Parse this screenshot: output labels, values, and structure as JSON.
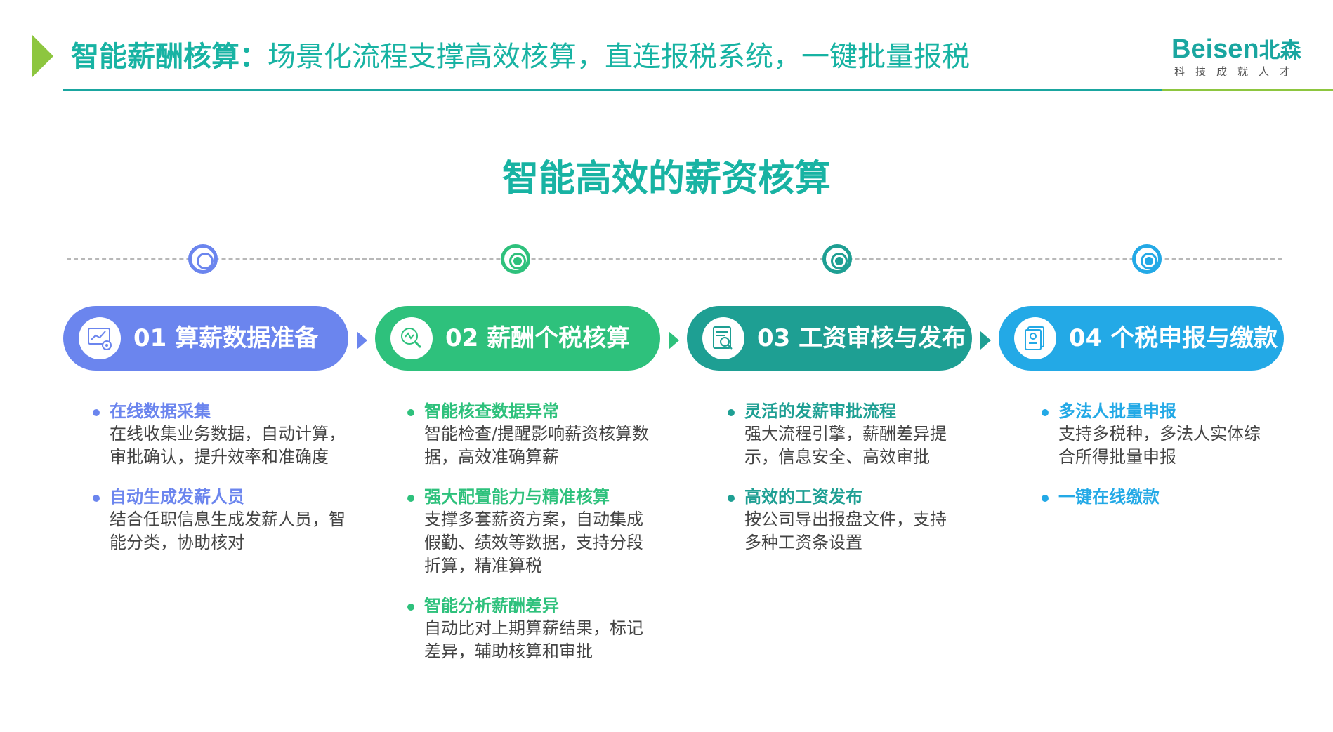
{
  "header": {
    "title_bold": "智能薪酬核算：",
    "title_rest": "场景化流程支撑高效核算，直连报税系统，一键批量报税",
    "logo_word": "Beisen",
    "logo_cn": "北森",
    "logo_sub": "科技成就人才"
  },
  "section_title": "智能高效的薪资核算",
  "colors": {
    "teal": "#18b3a3",
    "green_accent": "#8dc63f",
    "step1": "#6b85ee",
    "step2": "#2ec17c",
    "step3": "#1e9f93",
    "step4": "#23a9e6"
  },
  "steps": [
    {
      "label": "01 算薪数据准备",
      "icon": "data-chart-icon",
      "items": [
        {
          "title": "在线数据采集",
          "desc": "在线收集业务数据，自动计算，审批确认，提升效率和准确度"
        },
        {
          "title": "自动生成发薪人员",
          "desc": "结合任职信息生成发薪人员，智能分类，协助核对"
        }
      ]
    },
    {
      "label": "02 薪酬个税核算",
      "icon": "magnifier-check-icon",
      "items": [
        {
          "title": "智能核查数据异常",
          "desc": "智能检查/提醒影响薪资核算数据，高效准确算薪"
        },
        {
          "title": "强大配置能力与精准核算",
          "desc": "支撑多套薪资方案，自动集成假勤、绩效等数据，支持分段折算，精准算税"
        },
        {
          "title": "智能分析薪酬差异",
          "desc": "自动比对上期算薪结果，标记差异，辅助核算和审批"
        }
      ]
    },
    {
      "label": "03 工资审核与发布",
      "icon": "document-search-icon",
      "items": [
        {
          "title": "灵活的发薪审批流程",
          "desc": "强大流程引擎，薪酬差异提示，信息安全、高效审批"
        },
        {
          "title": "高效的工资发布",
          "desc": "按公司导出报盘文件，支持多种工资条设置"
        }
      ]
    },
    {
      "label": "04 个税申报与缴款",
      "icon": "tax-document-icon",
      "items": [
        {
          "title": "多法人批量申报",
          "desc": "支持多税种，多法人实体综合所得批量申报"
        },
        {
          "title": "一键在线缴款",
          "desc": ""
        }
      ]
    }
  ]
}
